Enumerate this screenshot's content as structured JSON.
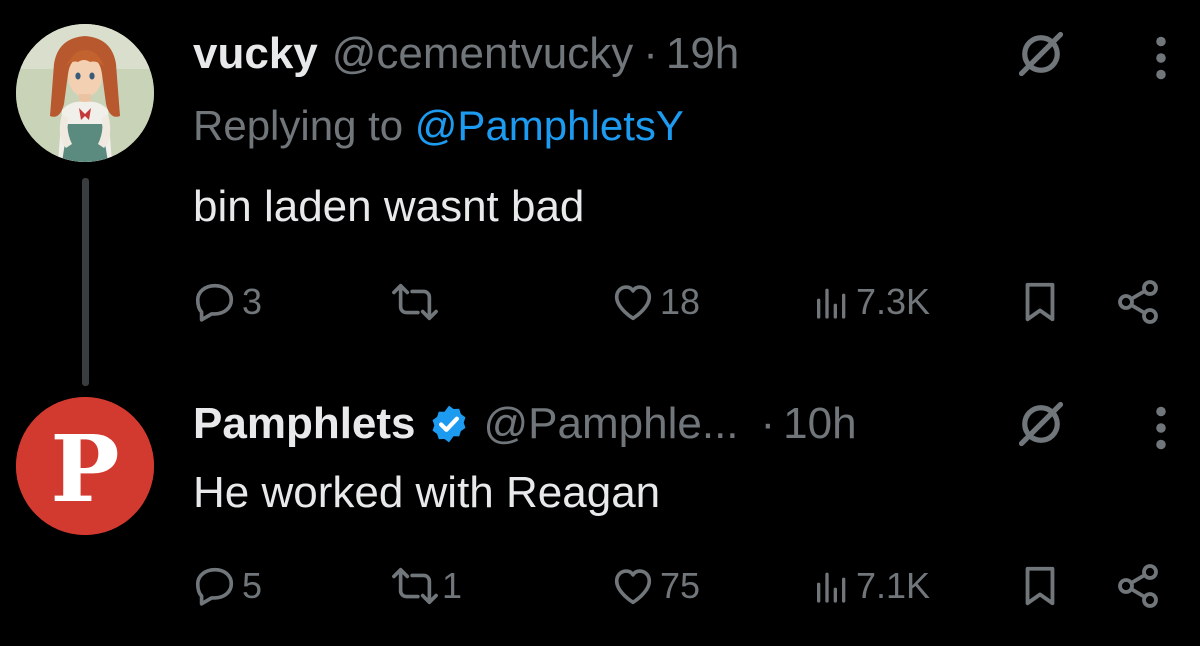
{
  "thread": [
    {
      "display_name": "vucky",
      "handle": "@cementvucky",
      "separator": "·",
      "time": "19h",
      "reply_prefix": "Replying to",
      "reply_handle": "@PamphletsY",
      "text": "bin laden wasnt bad",
      "avatar_icon": "anime-girl-avatar",
      "stats": {
        "replies": "3",
        "reposts": "",
        "likes": "18",
        "views": "7.3K"
      }
    },
    {
      "display_name": "Pamphlets",
      "verified": true,
      "handle": "@Pamphle...",
      "separator": "·",
      "time": "10h",
      "text": "He worked with Reagan",
      "avatar_icon": "letter-p-logo",
      "avatar_letter": "P",
      "stats": {
        "replies": "5",
        "reposts": "1",
        "likes": "75",
        "views": "7.1K"
      }
    }
  ],
  "colors": {
    "background": "#000000",
    "primary_text": "#e7e9ea",
    "secondary_text": "#71767b",
    "link": "#1d9bf0",
    "verified_badge": "#1d9bf0",
    "thread_line": "#3a3d40",
    "pamphlets_avatar": "#d33a2f"
  },
  "icons": [
    "reply-icon",
    "repost-icon",
    "like-icon",
    "views-icon",
    "bookmark-icon",
    "share-icon",
    "mute-icon",
    "more-icon",
    "verified-badge-icon"
  ]
}
